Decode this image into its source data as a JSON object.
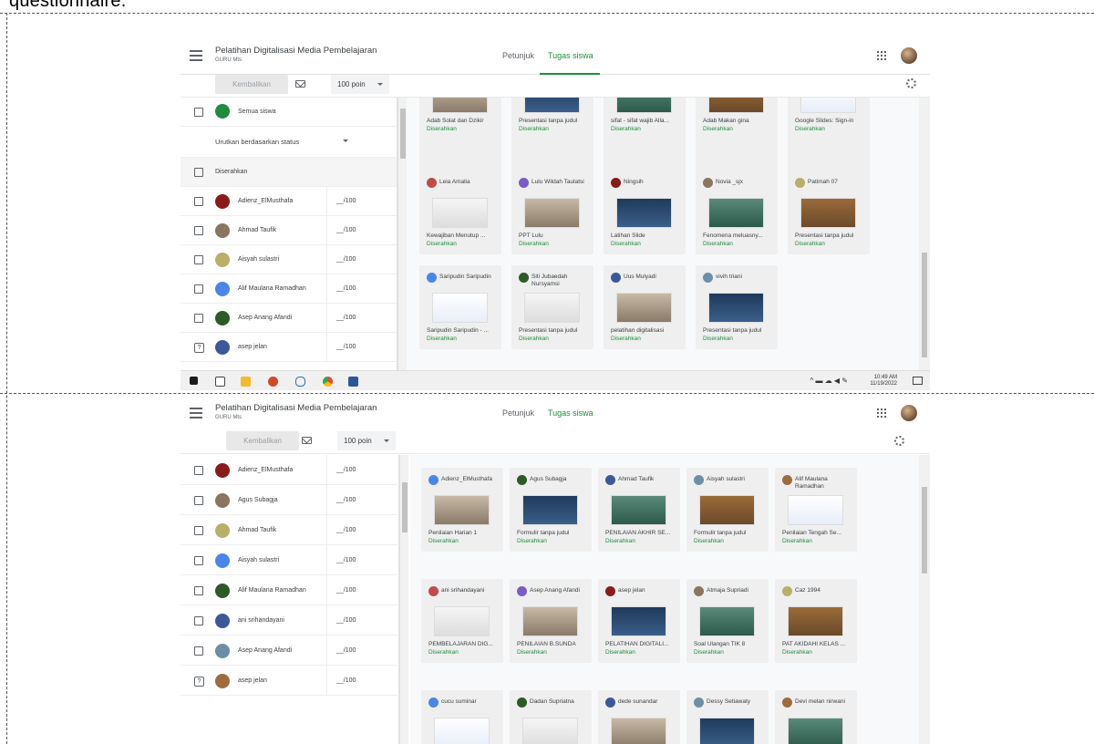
{
  "caption": "questionnaire.",
  "app": {
    "title": "Pelatihan Digitalisasi Media Pembelajaran",
    "subtitle": "GURU Mts",
    "tab_instructions": "Petunjuk",
    "tab_student_work": "Tugas siswa",
    "return_button": "Kembalikan",
    "points": "100 poin"
  },
  "panel1": {
    "all_students": "Semua siswa",
    "sort_label": "Urutkan berdasarkan status",
    "section_label": "Diserahkan",
    "rows": [
      {
        "name": "Adienz_ElMusthafa",
        "score": "__/100"
      },
      {
        "name": "Ahmad Taufik",
        "score": "__/100"
      },
      {
        "name": "Aisyah sulastri",
        "score": "__/100"
      },
      {
        "name": "Alif Maulana Ramadhan",
        "score": "__/100"
      },
      {
        "name": "Asep Anang Afandi",
        "score": "__/100"
      },
      {
        "name": "asep jelan",
        "score": "__/100"
      }
    ],
    "cards": [
      {
        "name": "",
        "title": "Adab Solat dan Dzikir",
        "status": "Diserahkan"
      },
      {
        "name": "",
        "title": "Presentasi tanpa judul",
        "status": "Diserahkan"
      },
      {
        "name": "",
        "title": "sifat - sifat wajib Alla...",
        "status": "Diserahkan"
      },
      {
        "name": "",
        "title": "Adab Makan gina",
        "status": "Diserahkan"
      },
      {
        "name": "",
        "title": "Google Slides: Sign-in",
        "status": "Diserahkan"
      },
      {
        "name": "Leia Amalia",
        "title": "Kewajiban Menutup ...",
        "status": "Diserahkan"
      },
      {
        "name": "Lulu Wildah Taulatsi",
        "title": "PPT Lulu",
        "status": "Diserahkan"
      },
      {
        "name": "Ningsih",
        "title": "Latihan Slide",
        "status": "Diserahkan"
      },
      {
        "name": "Novia _sjx",
        "title": "Fenomena meluasny...",
        "status": "Diserahkan"
      },
      {
        "name": "Patimah 07",
        "title": "Presentasi tanpa judul",
        "status": "Diserahkan"
      },
      {
        "name": "Saripudin Saripudin",
        "title": "Saripudin Saripudin - ...",
        "status": "Diserahkan"
      },
      {
        "name": "Siti Jubaedah Nursyamsi",
        "title": "Presentasi tanpa judul",
        "status": "Diserahkan"
      },
      {
        "name": "Uus Mulyadi",
        "title": "pelatihan digitalisasi",
        "status": "Diserahkan"
      },
      {
        "name": "vivih triani",
        "title": "Presentasi tanpa judul",
        "status": "Diserahkan"
      }
    ],
    "clock_time": "10:49 AM",
    "clock_date": "11/19/2022"
  },
  "panel2": {
    "rows": [
      {
        "name": "Adienz_ElMusthafa",
        "score": "__/100"
      },
      {
        "name": "Agus Subagja",
        "score": "__/100"
      },
      {
        "name": "Ahmad Taufik",
        "score": "__/100"
      },
      {
        "name": "Aisyah sulastri",
        "score": "__/100"
      },
      {
        "name": "Alif Maulana Ramadhan",
        "score": "__/100"
      },
      {
        "name": "ani srihandayani",
        "score": "__/100"
      },
      {
        "name": "Asep Anang Afandi",
        "score": "__/100"
      },
      {
        "name": "asep jelan",
        "score": "__/100"
      }
    ],
    "cards": [
      {
        "name": "Adienz_ElMusthafa",
        "title": "Penilaian Harian 1",
        "status": "Diserahkan"
      },
      {
        "name": "Agus Subagja",
        "title": "Formulir tanpa judul",
        "status": "Diserahkan"
      },
      {
        "name": "Ahmad Taufik",
        "title": "PENILAIAN AKHIR SE...",
        "status": "Diserahkan"
      },
      {
        "name": "Aisyah sulastri",
        "title": "Formulir tanpa judul",
        "status": "Diserahkan"
      },
      {
        "name": "Alif Maulana Ramadhan",
        "title": "Penilaian Tengah Se...",
        "status": "Diserahkan"
      },
      {
        "name": "ani srihandayani",
        "title": "PEMBELAJARAN DIG...",
        "status": "Diserahkan"
      },
      {
        "name": "Asep Anang Afandi",
        "title": "PENILAIAN B.SUNDA",
        "status": "Diserahkan"
      },
      {
        "name": "asep jelan",
        "title": "PELATIHAN DIGITALI...",
        "status": "Diserahkan"
      },
      {
        "name": "Atmaja Supriadi",
        "title": "Soal Ulangan TIK 8",
        "status": "Diserahkan"
      },
      {
        "name": "Caz 1994",
        "title": "PAT AKIDAHI KELAS ...",
        "status": "Diserahkan"
      },
      {
        "name": "cucu suminar",
        "title": "",
        "status": ""
      },
      {
        "name": "Dadan Supriatna",
        "title": "",
        "status": ""
      },
      {
        "name": "dede sunandar",
        "title": "",
        "status": ""
      },
      {
        "name": "Dessy Setiawaty",
        "title": "",
        "status": ""
      },
      {
        "name": "Devi melan nirwani",
        "title": "",
        "status": ""
      }
    ]
  }
}
